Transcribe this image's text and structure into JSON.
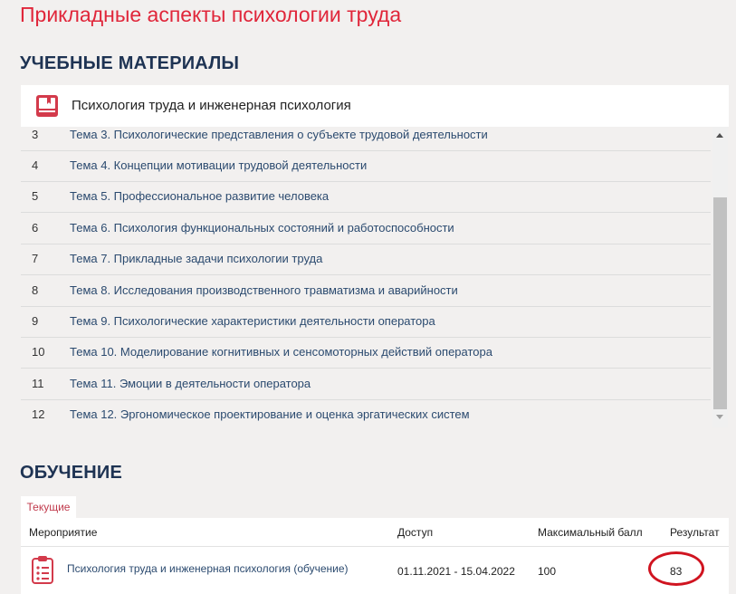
{
  "page": {
    "title": "Прикладные аспекты психологии труда",
    "accent_color": "#e0263a"
  },
  "materials": {
    "section_title": "УЧЕБНЫЕ МАТЕРИАЛЫ",
    "course": {
      "icon": "book-icon",
      "name": "Психология труда и инженерная психология"
    },
    "topics": [
      {
        "num": "3",
        "title": "Тема 3. Психологические представления о субъекте трудовой деятельности"
      },
      {
        "num": "4",
        "title": "Тема 4. Концепции мотивации трудовой деятельности"
      },
      {
        "num": "5",
        "title": "Тема 5. Профессиональное развитие человека"
      },
      {
        "num": "6",
        "title": "Тема 6. Психология функциональных состояний и работоспособности"
      },
      {
        "num": "7",
        "title": "Тема 7. Прикладные задачи психологии труда"
      },
      {
        "num": "8",
        "title": "Тема 8. Исследования производственного травматизма и аварийности"
      },
      {
        "num": "9",
        "title": "Тема 9. Психологические характеристики деятельности оператора"
      },
      {
        "num": "10",
        "title": "Тема 10. Моделирование когнитивных и сенсомоторных действий оператора"
      },
      {
        "num": "11",
        "title": "Тема 11. Эмоции в деятельности оператора"
      },
      {
        "num": "12",
        "title": "Тема 12. Эргономическое проектирование и оценка эргатических систем"
      }
    ]
  },
  "learning": {
    "section_title": "ОБУЧЕНИЕ",
    "tab_label": "Текущие",
    "columns": {
      "event": "Мероприятие",
      "access": "Доступ",
      "max_score": "Максимальный балл",
      "result": "Результат"
    },
    "rows": [
      {
        "icon": "clipboard-list-icon",
        "event": "Психология труда и инженерная психология (обучение)",
        "access": "01.11.2021 - 15.04.2022",
        "max_score": "100",
        "result": "83"
      }
    ]
  }
}
